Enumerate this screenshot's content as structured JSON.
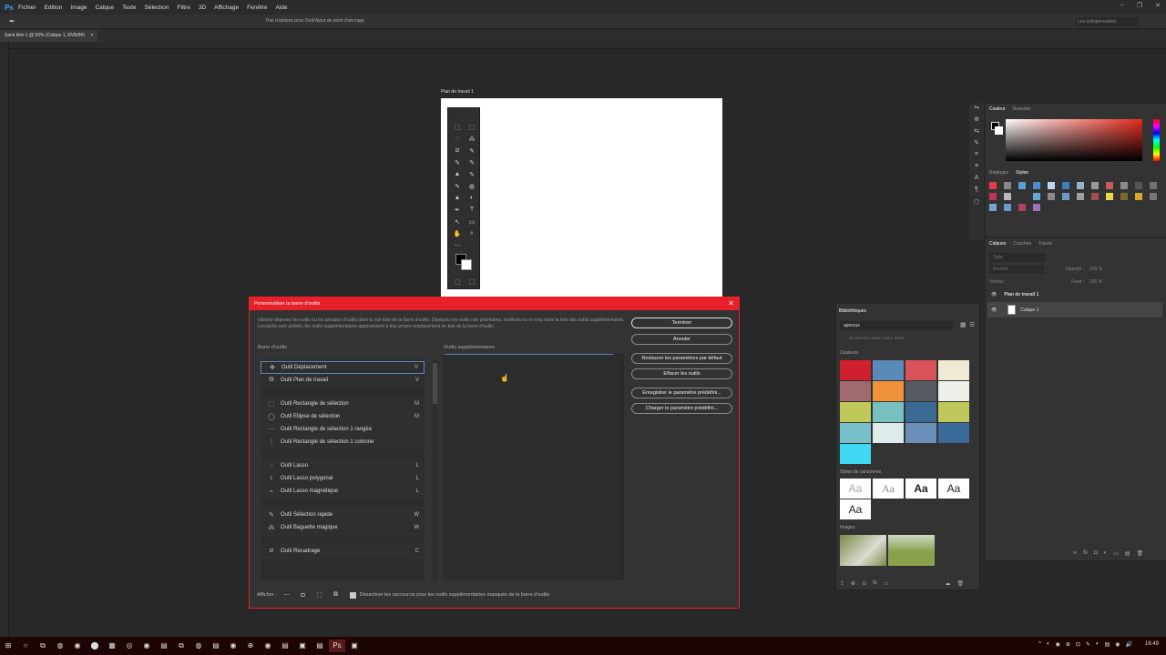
{
  "app": {
    "logo": "Ps"
  },
  "menu": [
    "Fichier",
    "Edition",
    "Image",
    "Calque",
    "Texte",
    "Sélection",
    "Filtre",
    "3D",
    "Affichage",
    "Fenêtre",
    "Aide"
  ],
  "window_controls": [
    "–",
    "❐",
    "✕"
  ],
  "options_bar": {
    "hint": "Pas d'options pour Outil Ajout de point d'ancrage.",
    "workspace": "Les indispensables"
  },
  "document": {
    "tab": "Sans titre-1 @ 50% (Calque 1, RVB/8#)",
    "tab_close": "×",
    "artboard_label": "Plan de travail 1"
  },
  "toolbox": [
    "⬚",
    "⬚",
    "◌",
    "⁂",
    "⧄",
    "✎",
    "✎",
    "✎",
    "▲",
    "✎",
    "✎",
    "◍",
    "▲",
    "◐",
    "✒",
    "T",
    "↖",
    "▭",
    "✋",
    "⌕",
    "⋯",
    "⬚",
    "⬚"
  ],
  "dialog": {
    "title": "Personnaliser la barre d'outils",
    "close": "✕",
    "description": "Glissez-déposez les outils ou les groupes d'outils dans la vue liste de la barre d'outils. Déplacez les outils non prioritaires, inutilisés ou en trop dans la liste des outils supplémentaires. Lorsqu'ils sont activés, les outils supplémentaires apparaissent à leur propre emplacement en bas de la barre d'outils.",
    "toolbar_label": "Barre d'outils",
    "extra_label": "Outils supplémentaires",
    "groups": [
      [
        {
          "icon": "✥",
          "name": "Outil Déplacement",
          "key": "V"
        },
        {
          "icon": "⧉",
          "name": "Outil Plan de travail",
          "key": "V"
        }
      ],
      [
        {
          "icon": "⬚",
          "name": "Outil Rectangle de sélection",
          "key": "M"
        },
        {
          "icon": "◯",
          "name": "Outil Ellipse de sélection",
          "key": "M"
        },
        {
          "icon": "⋯",
          "name": "Outil Rectangle de sélection 1 rangée",
          "key": ""
        },
        {
          "icon": "⋮",
          "name": "Outil Rectangle de sélection 1 colonne",
          "key": ""
        }
      ],
      [
        {
          "icon": "◌",
          "name": "Outil Lasso",
          "key": "L"
        },
        {
          "icon": "⌇",
          "name": "Outil Lasso polygonal",
          "key": "L"
        },
        {
          "icon": "⌁",
          "name": "Outil Lasso magnétique",
          "key": "L"
        }
      ],
      [
        {
          "icon": "✎",
          "name": "Outil Sélection rapide",
          "key": "W"
        },
        {
          "icon": "⁂",
          "name": "Outil Baguette magique",
          "key": "W"
        }
      ],
      [
        {
          "icon": "⧄",
          "name": "Outil Recadrage",
          "key": "C"
        }
      ]
    ],
    "buttons": {
      "done": "Terminer",
      "cancel": "Annuler",
      "restore": "Restaurer les paramètres par défaut",
      "clear": "Effacer les outils",
      "save": "Enregistrer le paramètre prédéfini...",
      "load": "Charger le paramètre prédéfini..."
    },
    "show_label": "Afficher :",
    "show_icons": [
      "⋯",
      "◘",
      "⬚",
      "⧉"
    ],
    "disable_shortcuts_label": "Désactiver les raccourcis pour les outils supplémentaires masqués de la barre d'outils"
  },
  "panel_strip": [
    "⇋",
    "⊕",
    "⇆",
    "✎",
    "⌗",
    "≡",
    "A",
    "¶",
    "⬡"
  ],
  "color_panel": {
    "tabs": [
      "Couleur",
      "Nuancier"
    ]
  },
  "styles_panel": {
    "tabs": [
      "Réglages",
      "Styles"
    ]
  },
  "style_swatches": [
    "#e63b4a",
    "#888888",
    "#5a9fd4",
    "#4a8fc8",
    "#bcd6ee",
    "#3d7fc2",
    "#9ab0c8",
    "#9b9b9b",
    "#c85a5a",
    "#8c8c8c",
    "#555555",
    "#707070",
    "#c23355",
    "#b8b8b8",
    "#333333",
    "#6aa5d8",
    "#8a8a8a",
    "#6a9bd0",
    "#a0a0a0",
    "#a05050",
    "#e8d84a",
    "#7a6a2a",
    "#d4a82a",
    "#777777",
    "#7aa0d0",
    "#6a98d0",
    "#b04060",
    "#a070c0"
  ],
  "layers_panel": {
    "tabs": [
      "Calques",
      "Couches",
      "Tracés"
    ],
    "search": "Type",
    "blend": "Normal",
    "opacity_label": "Opacité :",
    "opacity": "100 %",
    "lock_label": "Verrou :",
    "fill_label": "Fond :",
    "fill": "100 %",
    "rows": [
      {
        "name": "Plan de travail 1"
      },
      {
        "name": "Calque 1"
      }
    ],
    "footer_icons": [
      "∞",
      "fx",
      "◘",
      "◐",
      "▭",
      "▤",
      "🗑"
    ]
  },
  "libraries": {
    "title": "Bibliothèques",
    "selected": "apercus",
    "search_placeholder": "Rechercher dans Adobe Stock",
    "colors_label": "Couleurs",
    "colors": [
      "#d0202e",
      "#5a8ab8",
      "#d9545a",
      "#f0ead4",
      "#a06a6e",
      "#f0923a",
      "#555a60",
      "#eef0ea",
      "#c0c85a",
      "#78c0c0",
      "#3a6a94",
      "#c0c85a",
      "#78c0c8",
      "#dcecec",
      "#6a90b8",
      "#3a6a9a",
      "#40d8f4"
    ],
    "chars_label": "Styles de caractères",
    "chars": [
      "Aa",
      "Aa",
      "Aa",
      "Aa",
      "Aa"
    ],
    "images_label": "Images",
    "images": [
      "#7a8a4a",
      "#8aa04a"
    ],
    "footer_icons": [
      "⇪",
      "⊕",
      "⊙",
      "fx",
      "▭",
      "☁",
      "🗑"
    ]
  },
  "taskbar": {
    "icons": [
      "⊞",
      "○",
      "⧉",
      "◍",
      "◉",
      "⬤",
      "▦",
      "◎",
      "◉",
      "▤",
      "⧉",
      "◍",
      "▤",
      "◉",
      "⊕",
      "◉",
      "▤",
      "▣",
      "▤",
      "Ps",
      "▣"
    ],
    "tray": [
      "^",
      "◐",
      "◉",
      "⊕",
      "⊡",
      "✎",
      "◐",
      "▤",
      "◉",
      "🔊"
    ],
    "time": "16:49"
  }
}
